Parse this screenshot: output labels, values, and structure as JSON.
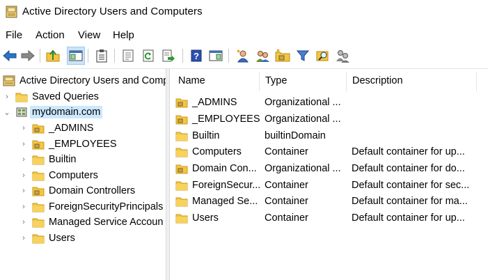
{
  "window": {
    "title": "Active Directory Users and Computers"
  },
  "menu": [
    "File",
    "Action",
    "View",
    "Help"
  ],
  "toolbar": {
    "buttons": [
      {
        "icon": "back-arrow-icon"
      },
      {
        "icon": "forward-arrow-icon"
      },
      {
        "icon": "up-folder-icon"
      },
      {
        "icon": "show-hide-tree-icon",
        "active": true
      },
      {
        "icon": "clipboard-icon"
      },
      {
        "icon": "properties-icon"
      },
      {
        "icon": "refresh-icon"
      },
      {
        "icon": "export-list-icon"
      },
      {
        "icon": "help-icon"
      },
      {
        "icon": "console-view-icon"
      },
      {
        "icon": "new-user-icon"
      },
      {
        "icon": "new-group-icon"
      },
      {
        "icon": "new-ou-icon"
      },
      {
        "icon": "filter-icon"
      },
      {
        "icon": "find-icon"
      },
      {
        "icon": "add-to-group-icon"
      }
    ]
  },
  "tree": {
    "root": "Active Directory Users and Comp",
    "items": [
      {
        "label": "Saved Queries",
        "icon": "folder",
        "level": 1
      },
      {
        "label": "mydomain.com",
        "icon": "domain",
        "level": 1,
        "selected": true,
        "expanded": true
      },
      {
        "label": "_ADMINS",
        "icon": "ou",
        "level": 2
      },
      {
        "label": "_EMPLOYEES",
        "icon": "ou",
        "level": 2
      },
      {
        "label": "Builtin",
        "icon": "folder",
        "level": 2
      },
      {
        "label": "Computers",
        "icon": "folder",
        "level": 2
      },
      {
        "label": "Domain Controllers",
        "icon": "ou",
        "level": 2
      },
      {
        "label": "ForeignSecurityPrincipals",
        "icon": "folder",
        "level": 2
      },
      {
        "label": "Managed Service Accoun",
        "icon": "folder",
        "level": 2
      },
      {
        "label": "Users",
        "icon": "folder",
        "level": 2
      }
    ]
  },
  "list": {
    "columns": [
      "Name",
      "Type",
      "Description"
    ],
    "rows": [
      {
        "name": "_ADMINS",
        "type": "Organizational ...",
        "description": "",
        "icon": "ou"
      },
      {
        "name": "_EMPLOYEES",
        "type": "Organizational ...",
        "description": "",
        "icon": "ou"
      },
      {
        "name": "Builtin",
        "type": "builtinDomain",
        "description": "",
        "icon": "folder"
      },
      {
        "name": "Computers",
        "type": "Container",
        "description": "Default container for up...",
        "icon": "folder"
      },
      {
        "name": "Domain Con...",
        "type": "Organizational ...",
        "description": "Default container for do...",
        "icon": "ou"
      },
      {
        "name": "ForeignSecur...",
        "type": "Container",
        "description": "Default container for sec...",
        "icon": "folder"
      },
      {
        "name": "Managed Se...",
        "type": "Container",
        "description": "Default container for ma...",
        "icon": "folder"
      },
      {
        "name": "Users",
        "type": "Container",
        "description": "Default container for up...",
        "icon": "folder"
      }
    ]
  },
  "colors": {
    "folder": "#f4c542",
    "folder_dark": "#d9a520",
    "selection": "#cce8ff",
    "accent_blue": "#2b74c7"
  }
}
